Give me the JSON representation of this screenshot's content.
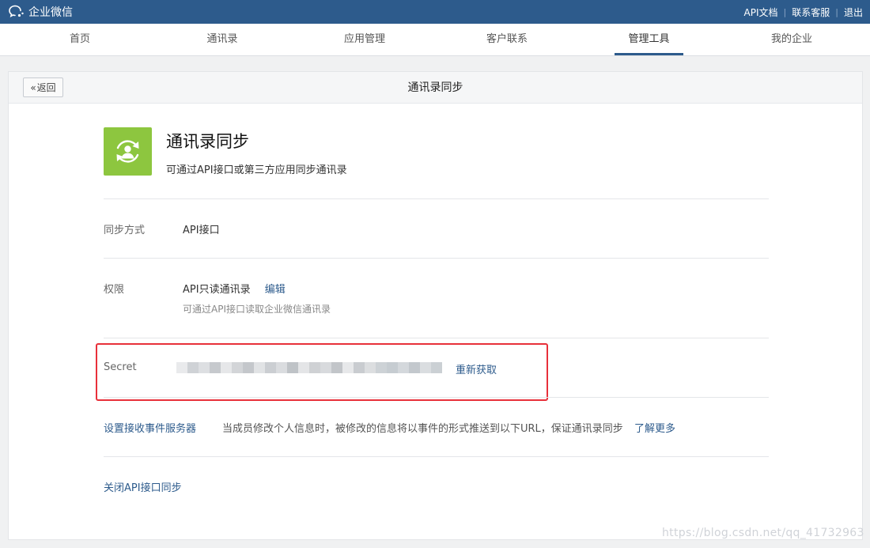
{
  "topbar": {
    "brand": "企业微信",
    "links": [
      "API文档",
      "联系客服",
      "退出"
    ],
    "separator": "|"
  },
  "nav": {
    "items": [
      "首页",
      "通讯录",
      "应用管理",
      "客户联系",
      "管理工具",
      "我的企业"
    ],
    "active": "管理工具"
  },
  "panel": {
    "back_chevron": "«",
    "back_label": "返回",
    "title": "通讯录同步"
  },
  "app": {
    "icon": "person-sync-icon",
    "icon_bg": "#8dc63f",
    "title": "通讯录同步",
    "desc": "可通过API接口或第三方应用同步通讯录"
  },
  "sync_method": {
    "label": "同步方式",
    "value": "API接口"
  },
  "permission": {
    "label": "权限",
    "value": "API只读通讯录",
    "edit": "编辑",
    "hint": "可通过API接口读取企业微信通讯录"
  },
  "secret": {
    "label": "Secret",
    "refresh": "重新获取",
    "highlight_color": "#e8303a"
  },
  "event_server": {
    "link": "设置接收事件服务器",
    "desc": "当成员修改个人信息时，被修改的信息将以事件的形式推送到以下URL，保证通讯录同步",
    "more": "了解更多"
  },
  "close_api": "关闭API接口同步",
  "watermark": "https://blog.csdn.net/qq_41732963",
  "colors": {
    "topbar": "#2d5b8c",
    "link": "#2d5b8c"
  }
}
